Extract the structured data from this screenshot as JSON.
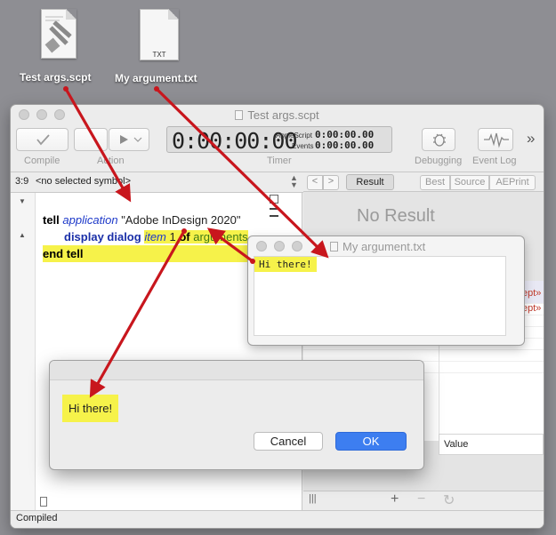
{
  "desktop": {
    "icons": [
      {
        "label": "Test args.scpt",
        "icon": "applescript-file-icon"
      },
      {
        "label": "My argument.txt",
        "icon": "text-file-icon",
        "badge": "TXT"
      }
    ]
  },
  "window": {
    "title": "Test args.scpt",
    "toolbar": {
      "compile_label": "Compile",
      "action_label": "Action",
      "timer_label": "Timer",
      "debugging_label": "Debugging",
      "event_log_label": "Event Log",
      "more_glyph": "»"
    },
    "timer": {
      "main": "0:00:00:00",
      "applescript_label": "AppleScript",
      "applescript_value": "0:00:00.00",
      "events_label": "Events",
      "events_value": "0:00:00.00"
    },
    "nav": {
      "position": "3:9",
      "selection": "<no selected symbol>"
    },
    "code": {
      "line1": {
        "kw": "tell",
        "obj": "application",
        "str": " \"Adobe InDesign 2020\""
      },
      "line2": {
        "cmd": "display dialog",
        "obj": "item",
        "num": " 1 ",
        "of": "of",
        "var": "arguments"
      },
      "line3": {
        "kw": "end tell"
      }
    },
    "result_pane": {
      "result_button": "Result",
      "tabs": [
        "Best",
        "Source",
        "AEPrint"
      ],
      "no_result": "No Result",
      "partial_rows": [
        "ept»",
        "ept»"
      ],
      "value_header": "Value"
    },
    "status": "Compiled"
  },
  "text_window": {
    "title": "My argument.txt",
    "content": "Hi there!"
  },
  "dialog": {
    "message": "Hi there!",
    "cancel_label": "Cancel",
    "ok_label": "OK"
  },
  "colors": {
    "highlight": "#f6f24a",
    "arrow": "#c8161d",
    "ok_button": "#3d7ef0",
    "keyword_blue": "#1a2fa8"
  }
}
